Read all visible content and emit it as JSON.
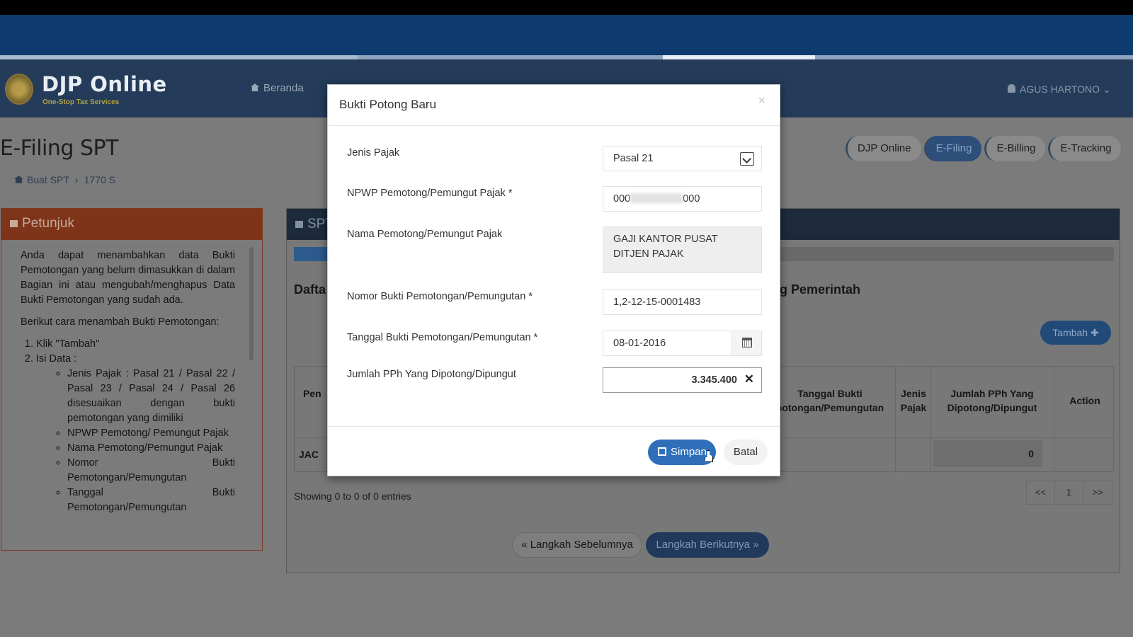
{
  "brand": {
    "title": "DJP Online",
    "subtitle": "One-Stop Tax Services"
  },
  "nav": {
    "beranda": "Beranda",
    "user": "AGUS HARTONO"
  },
  "page": {
    "title": "E-Filing SPT"
  },
  "breadcrumb": [
    "Buat SPT",
    "1770 S"
  ],
  "pills": [
    "DJP Online",
    "E-Filing",
    "E-Billing",
    "E-Tracking"
  ],
  "petunjuk": {
    "title": "Petunjuk",
    "intro": "Anda dapat menambahkan data Bukti Pemotongan yang belum dimasukkan di dalam Bagian ini atau mengubah/menghapus Data Bukti Pemotongan yang sudah ada.",
    "lead": "Berikut cara menambah Bukti Pemotongan:",
    "steps": [
      "Klik \"Tambah\"",
      "Isi Data :"
    ],
    "sub": [
      "Jenis Pajak : Pasal 21 / Pasal 22 / Pasal 23 / Pasal 24 / Pasal 26 disesuaikan dengan bukti pemotongan yang dimiliki",
      "NPWP Pemotong/ Pemungut Pajak",
      "Nama Pemotong/Pemungut Pajak",
      "Nomor Bukti Pemotongan/Pemungutan",
      "Tanggal Bukti Pemotongan/Pemungutan"
    ]
  },
  "main": {
    "header": "SPT",
    "daftar": "Dafta",
    "pemerintah": "g Pemerintah",
    "tambah": "Tambah ✚",
    "table": {
      "col_first": "Pen",
      "col_tanggal": "Tanggal Bukti\npotongan/Pemungutan",
      "col_jenis": "Jenis\nPajak",
      "col_jumlah": "Jumlah PPh Yang\nDipotong/Dipungut",
      "col_action": "Action",
      "row_label": "JAC",
      "total": "0"
    },
    "showing": "Showing 0 to 0 of 0 entries",
    "pager": [
      "<<",
      "1",
      ">>"
    ],
    "prev": "« Langkah Sebelumnya",
    "next": "Langkah Berikutnya »"
  },
  "modal": {
    "title": "Bukti Potong Baru",
    "close": "×",
    "fields": {
      "jenis_label": "Jenis Pajak",
      "jenis_value": "Pasal 21",
      "npwp_label": "NPWP Pemotong/Pemungut Pajak *",
      "npwp_start": "000",
      "npwp_end": "000",
      "nama_label": "Nama Pemotong/Pemungut Pajak",
      "nama_value": "GAJI KANTOR PUSAT DITJEN PAJAK",
      "nomor_label": "Nomor Bukti Pemotongan/Pemungutan *",
      "nomor_value": "1,2-12-15-0001483",
      "tanggal_label": "Tanggal Bukti Pemotongan/Pemungutan *",
      "tanggal_value": "08-01-2016",
      "jumlah_label": "Jumlah PPh Yang Dipotong/Dipungut",
      "jumlah_value": "3.345.400",
      "clear": "✕"
    },
    "simpan": "Simpan",
    "batal": "Batal"
  }
}
